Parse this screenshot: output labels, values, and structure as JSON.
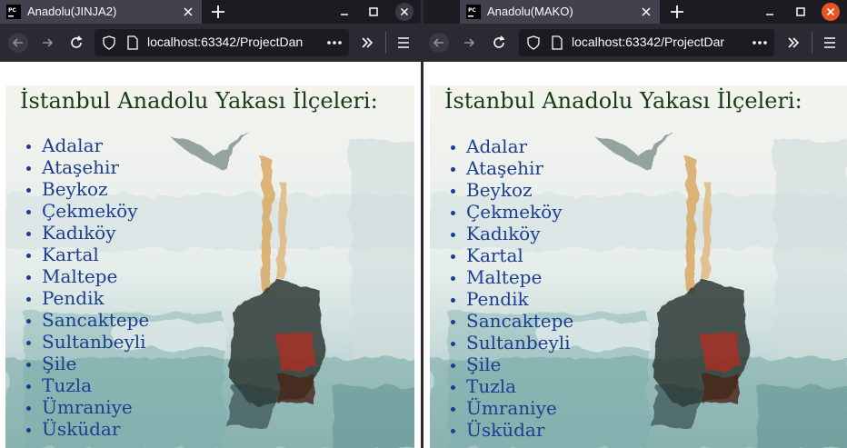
{
  "windows": [
    {
      "tab_title": "Anadolu(JINJA2)",
      "url": "localhost:63342/ProjectDan"
    },
    {
      "tab_title": "Anadolu(MAKO)",
      "url": "localhost:63342/ProjectDar"
    }
  ],
  "page": {
    "heading": "İstanbul Anadolu Yakası İlçeleri:",
    "districts": [
      "Adalar",
      "Ataşehir",
      "Beykoz",
      "Çekmeköy",
      "Kadıköy",
      "Kartal",
      "Maltepe",
      "Pendik",
      "Sancaktepe",
      "Sultanbeyli",
      "Şile",
      "Tuzla",
      "Ümraniye",
      "Üsküdar"
    ]
  },
  "icons": [
    "pycharm-icon",
    "close-icon",
    "plus-icon",
    "minimize-icon",
    "maximize-icon",
    "back-icon",
    "forward-icon",
    "reload-icon",
    "shield-icon",
    "page-icon",
    "more-icon",
    "overflow-icon",
    "menu-icon"
  ],
  "colors": {
    "tab_active": "#42414d",
    "toolbar": "#2b2a33",
    "urlbar": "#1c1b22",
    "close_button_active": "#e95420",
    "heading_text": "#163d16",
    "list_text": "#1b3e8f"
  }
}
